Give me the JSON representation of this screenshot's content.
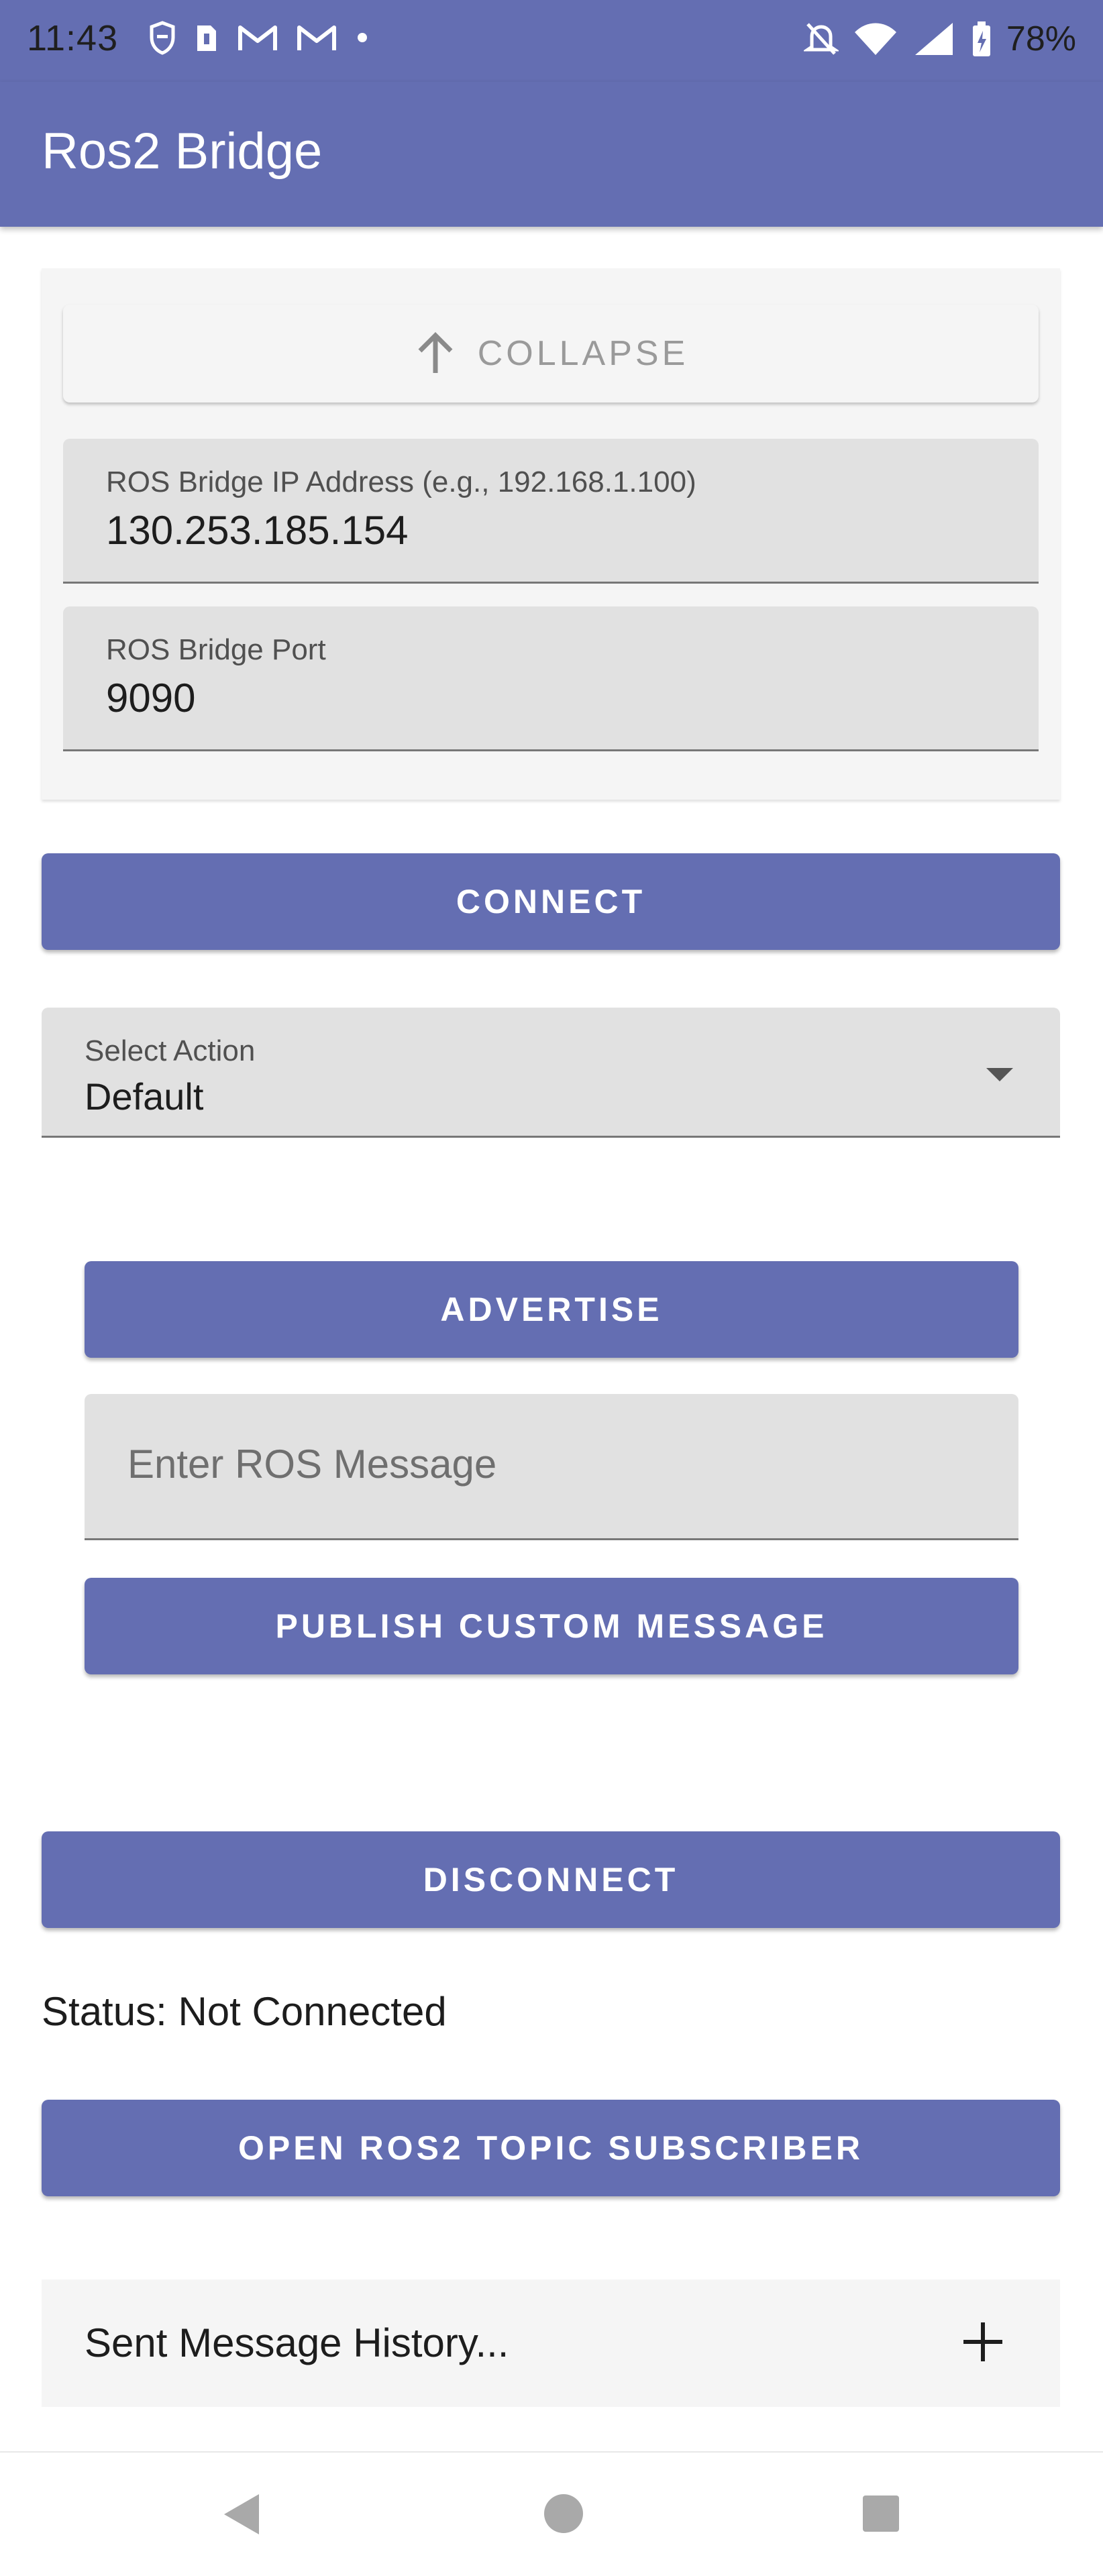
{
  "status_bar": {
    "time": "11:43",
    "battery_percent": "78%",
    "notification_icons": [
      "shield-icon",
      "file-icon",
      "gmail-icon",
      "gmail-icon",
      "dot-icon"
    ],
    "system_icons": [
      "bell-off-icon",
      "wifi-icon",
      "signal-icon",
      "battery-icon"
    ]
  },
  "app_bar": {
    "title": "Ros2 Bridge",
    "color": "#646eb2"
  },
  "settings_card": {
    "collapse_label": "COLLAPSE",
    "ip_field": {
      "label": "ROS Bridge IP Address (e.g., 192.168.1.100)",
      "value": "130.253.185.154"
    },
    "port_field": {
      "label": "ROS Bridge Port",
      "value": "9090"
    }
  },
  "buttons": {
    "connect": "CONNECT",
    "advertise": "ADVERTISE",
    "publish": "PUBLISH CUSTOM MESSAGE",
    "disconnect": "DISCONNECT",
    "open_subscriber": "OPEN ROS2 TOPIC SUBSCRIBER"
  },
  "action_select": {
    "label": "Select Action",
    "value": "Default"
  },
  "message_input": {
    "placeholder": "Enter ROS Message"
  },
  "status": {
    "text": "Status: Not Connected"
  },
  "history": {
    "label": "Sent Message History..."
  },
  "nav_bar": {
    "icons": [
      "back-icon",
      "home-icon",
      "recents-icon"
    ]
  }
}
